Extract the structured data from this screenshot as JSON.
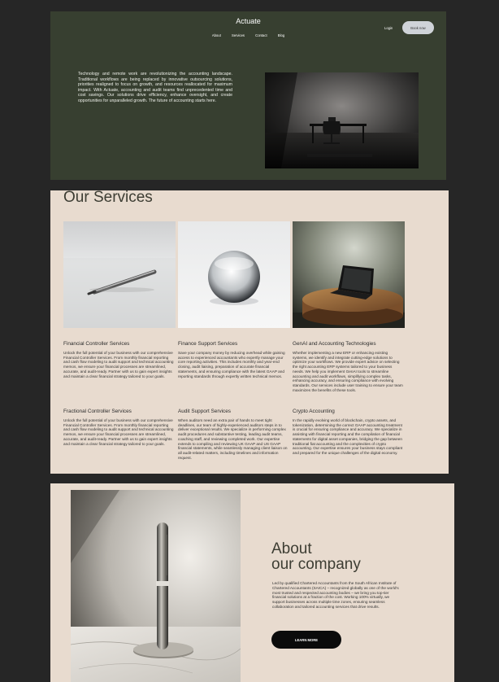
{
  "hero": {
    "brand": "Actuate",
    "nav": [
      "About",
      "Services",
      "Contact",
      "Blog"
    ],
    "login": "Login",
    "book": "Book now",
    "intro": "Technology and remote work are revolutionizing the accounting landscape. Traditional workflows are being replaced by innovative outsourcing solutions, priorities realigned to focus on growth, and resources reallocated for maximum impact. With Actuate, accounting and audit teams find unprecedented time and cost savings. Our solutions drive efficiency, enhance oversight, and create opportunities for unparalleled growth. The future of accounting starts here."
  },
  "services": {
    "title": "Our Services",
    "items": [
      {
        "title": "Financial Controller Services",
        "body": "Unlock the full potential of your business with our comprehensive Financial Controller Services. From monthly financial reporting and cash flow modeling to audit support and technical accounting memos, we ensure your financial processes are streamlined, accurate, and audit-ready. Partner with us to gain expert insights and maintain a clear financial strategy tailored to your goals."
      },
      {
        "title": "Finance Support Services",
        "body": "Save your company money by reducing overhead while gaining access to experienced accountants who expertly manage your core reporting activities. This includes monthly and year-end closing, audit liaising, preparation of accurate financial statements, and ensuring compliance with the latest GAAP and reporting standards through expertly written technical memos."
      },
      {
        "title": "GenAI and Accounting Technologies",
        "body": "Whether implementing a new ERP or enhancing existing systems, we identify and integrate cutting-edge solutions to optimize your workflows. We provide expert advice on selecting the right accounting ERP systems tailored to your business needs. We help you implement GenAI tools to streamline accounting and audit workflows, simplifying complex tasks, enhancing accuracy, and ensuring compliance with evolving standards. Our services include user training to ensure your team maximizes the benefits of these tools."
      },
      {
        "title": "Fractional Controller Services",
        "body": "Unlock the full potential of your business with our comprehensive Financial Controller Services. From monthly financial reporting and cash flow modeling to audit support and technical accounting memos, we ensure your financial processes are streamlined, accurate, and audit-ready. Partner with us to gain expert insights and maintain a clear financial strategy tailored to your goals."
      },
      {
        "title": "Audit Support Services",
        "body": "When auditors need an extra pair of hands to meet tight deadlines, our team of highly-experienced auditors steps in to deliver exceptional results. We specialize in performing complex audit procedures and substantive testing, leading audit teams, coaching staff, and reviewing completed work. Our expertise extends to compiling and reviewing UK GAAP and US GAAP financial statements, while seamlessly managing client liaison on all audit-related matters, including timelines and information request."
      },
      {
        "title": "Crypto Accounting",
        "body": "In the rapidly evolving world of blockchain, crypto assets, and tokenization, determining the correct GAAP accounting treatment is crucial for ensuring compliance and accuracy. We specialize in assisting with financial reporting and the compilation of financial statements for digital asset companies, bridging the gap between traditional fiat accounting and the complexities of crypto accounting. Our expertise ensures your business stays compliant and prepared for the unique challenges of the digital economy."
      }
    ]
  },
  "about": {
    "title_line1": "About",
    "title_line2": "our company",
    "body": "Led by qualified Chartered Accountants from the South African Institute of Chartered Accountants (SAICA) – recognized globally as one of the world's most trusted and respected accounting bodies – we bring you top-tier financial solutions at a fraction of the cost. Working 100% virtually, we support businesses across multiple time zones, ensuring seamless collaboration and tailored accounting services that drive results.",
    "cta": "LEARN MORE"
  }
}
